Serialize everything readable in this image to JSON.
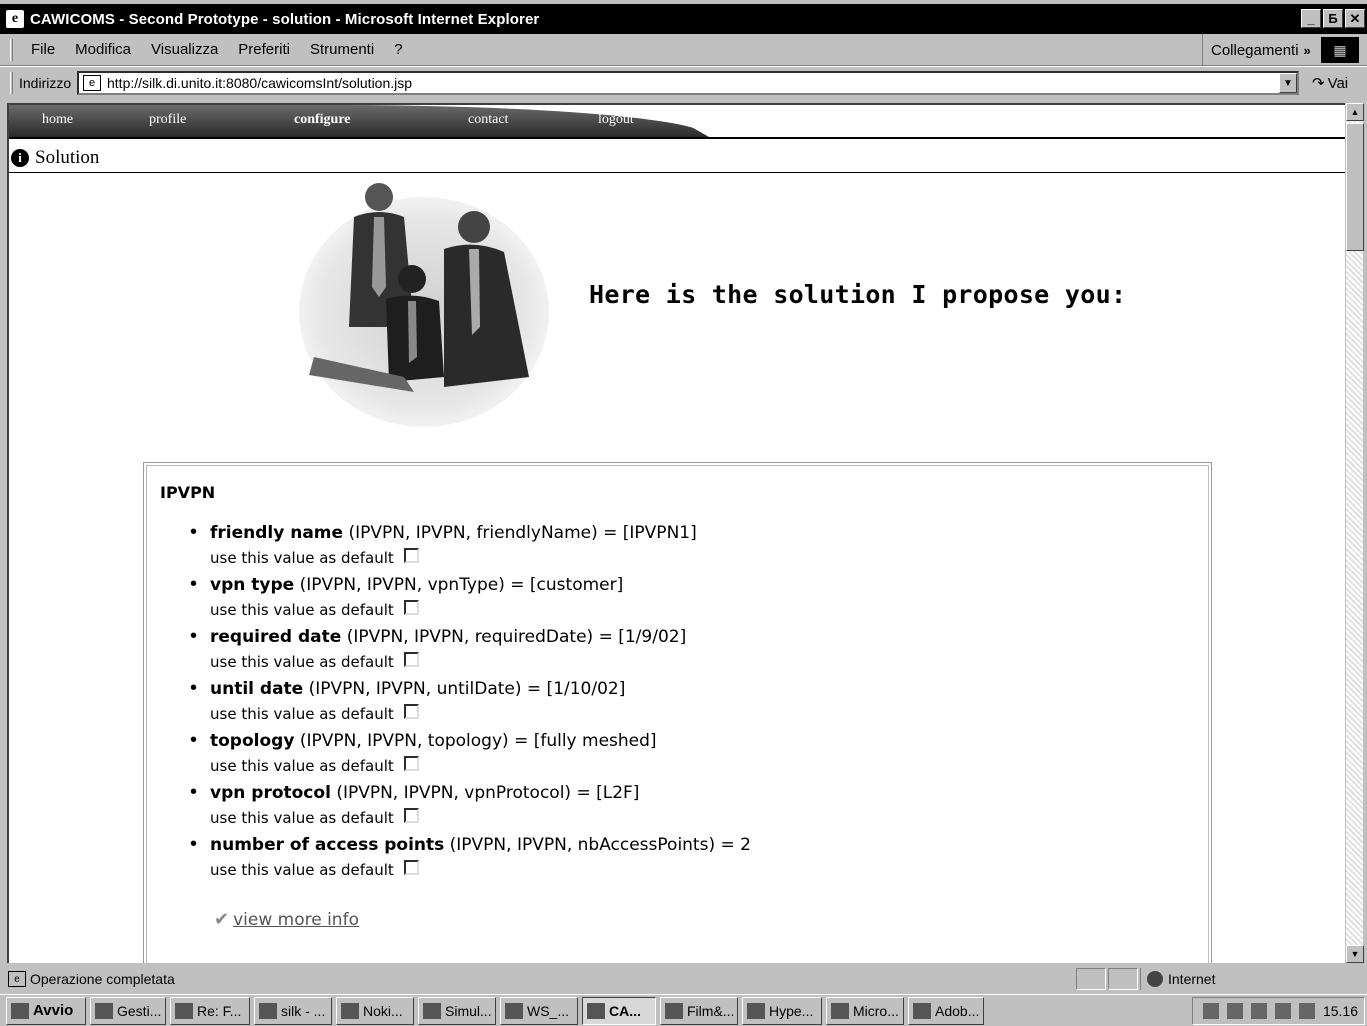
{
  "window": {
    "title": "CAWICOMS - Second Prototype - solution - Microsoft Internet Explorer",
    "ie_icon_glyph": "e",
    "buttons": {
      "minimize": "_",
      "restore": "Б",
      "close": "✕"
    }
  },
  "menubar": {
    "items": [
      {
        "label": "File"
      },
      {
        "label": "Modifica"
      },
      {
        "label": "Visualizza"
      },
      {
        "label": "Preferiti"
      },
      {
        "label": "Strumenti"
      },
      {
        "label": "?"
      }
    ],
    "links_label": "Collegamenti",
    "links_chevron": "»"
  },
  "addressbar": {
    "label": "Indirizzo",
    "url": "http://silk.di.unito.it:8080/cawicomsInt/solution.jsp",
    "go_label": "Vai"
  },
  "site_nav": {
    "items": [
      {
        "label": "home",
        "active": false
      },
      {
        "label": "profile",
        "active": false
      },
      {
        "label": "configure",
        "active": true
      },
      {
        "label": "contact",
        "active": false
      },
      {
        "label": "logout",
        "active": false
      }
    ]
  },
  "solution_header": {
    "icon_glyph": "i",
    "title": "Solution"
  },
  "headline": "Here is the solution I propose you:",
  "panel": {
    "title": "IPVPN",
    "default_label": "use this value as default",
    "params": [
      {
        "name": "friendly name",
        "detail": "(IPVPN, IPVPN, friendlyName) = [IPVPN1]",
        "default_checked": false
      },
      {
        "name": "vpn type",
        "detail": "(IPVPN, IPVPN, vpnType) = [customer]",
        "default_checked": false
      },
      {
        "name": "required date",
        "detail": "(IPVPN, IPVPN, requiredDate) = [1/9/02]",
        "default_checked": false
      },
      {
        "name": "until date",
        "detail": "(IPVPN, IPVPN, untilDate) = [1/10/02]",
        "default_checked": false
      },
      {
        "name": "topology",
        "detail": "(IPVPN, IPVPN, topology) = [fully meshed]",
        "default_checked": false
      },
      {
        "name": "vpn protocol",
        "detail": "(IPVPN, IPVPN, vpnProtocol) = [L2F]",
        "default_checked": false
      },
      {
        "name": "number of access points",
        "detail": "(IPVPN, IPVPN, nbAccessPoints) = 2",
        "default_checked": false
      }
    ],
    "more_info": "view more info"
  },
  "statusbar": {
    "text": "Operazione completata",
    "zone": "Internet"
  },
  "taskbar": {
    "start": "Avvio",
    "buttons": [
      {
        "label": "Gesti...",
        "active": false
      },
      {
        "label": "Re: F...",
        "active": false
      },
      {
        "label": "silk - ...",
        "active": false
      },
      {
        "label": "Noki...",
        "active": false
      },
      {
        "label": "Simul...",
        "active": false
      },
      {
        "label": "WS_...",
        "active": false
      },
      {
        "label": "CA...",
        "active": true
      },
      {
        "label": "Film&...",
        "active": false
      },
      {
        "label": "Hype...",
        "active": false
      },
      {
        "label": "Micro...",
        "active": false
      },
      {
        "label": "Adob...",
        "active": false
      }
    ],
    "clock": "15.16"
  }
}
